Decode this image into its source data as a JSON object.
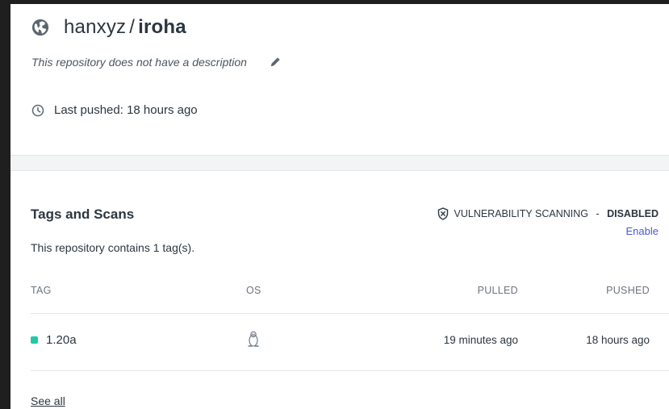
{
  "repo": {
    "owner": "hanxyz",
    "separator": "/",
    "name": "iroha",
    "description": "This repository does not have a description",
    "last_pushed": "Last pushed: 18 hours ago"
  },
  "tags_section": {
    "title": "Tags and Scans",
    "scan_label": "VULNERABILITY SCANNING",
    "scan_dash": " - ",
    "scan_state": "DISABLED",
    "enable_label": "Enable",
    "tag_count_text": "This repository contains 1 tag(s).",
    "columns": [
      "TAG",
      "OS",
      "PULLED",
      "PUSHED"
    ],
    "rows": [
      {
        "tag": "1.20a",
        "os_icon": "linux-icon",
        "pulled": "19 minutes ago",
        "pushed": "18 hours ago"
      }
    ],
    "see_all": "See all"
  },
  "icons": {
    "title_icon": "globe-icon",
    "edit_icon": "pencil-icon",
    "time_icon": "clock-icon",
    "scan_icon": "shield-x-icon"
  },
  "colors": {
    "accent_link": "#4b5acd",
    "status_dot": "#20c9a6",
    "backdrop": "#1f1f1f"
  }
}
